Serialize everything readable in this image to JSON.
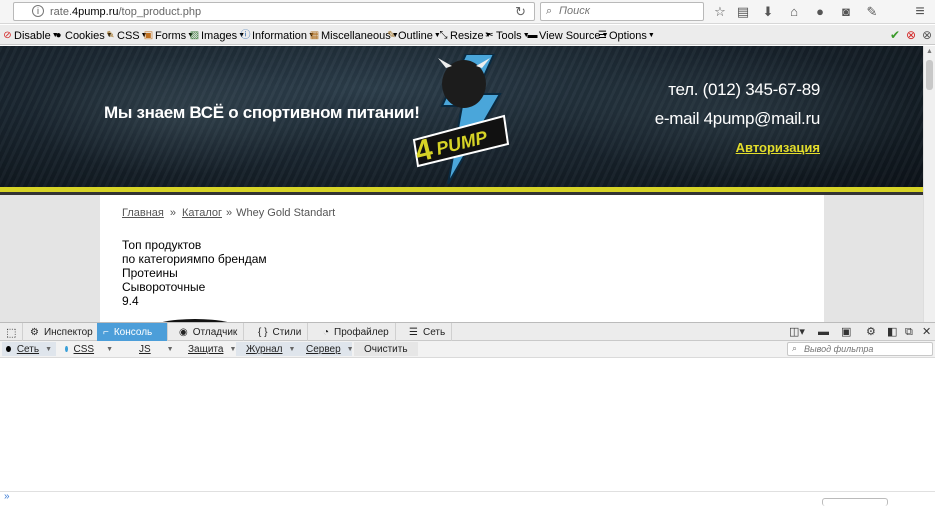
{
  "browser": {
    "url_prefix": "rate.",
    "url_domain": "4pump.ru",
    "url_path": "/top_product.php",
    "search_placeholder": "Поиск",
    "nav_icons": [
      "star-icon",
      "reading-list-icon",
      "download-icon",
      "home-icon",
      "chat-icon",
      "pocket-icon",
      "addon-icon",
      "menu-icon"
    ]
  },
  "webdev_toolbar": {
    "items": [
      {
        "label": "Disable",
        "icon": "no-entry-icon"
      },
      {
        "label": "Cookies",
        "icon": "cookie-icon"
      },
      {
        "label": "CSS",
        "icon": "pencil-icon"
      },
      {
        "label": "Forms",
        "icon": "form-icon"
      },
      {
        "label": "Images",
        "icon": "image-icon"
      },
      {
        "label": "Information",
        "icon": "info-icon"
      },
      {
        "label": "Miscellaneous",
        "icon": "misc-icon"
      },
      {
        "label": "Outline",
        "icon": "outline-icon"
      },
      {
        "label": "Resize",
        "icon": "resize-icon"
      },
      {
        "label": "Tools",
        "icon": "tools-icon"
      },
      {
        "label": "View Source",
        "icon": "view-source-icon"
      },
      {
        "label": "Options",
        "icon": "options-icon"
      }
    ],
    "status_ok_color": "#3a9a2a",
    "status_error_color": "#d32323"
  },
  "site": {
    "slogan": "Мы знаем ВСЁ о спортивном питании!",
    "logo_text": "4PUMP",
    "phone": "тел. (012) 345-67-89",
    "email": "e-mail 4pump@mail.ru",
    "login_link": "Авторизация",
    "accent_color": "#d6d326",
    "breadcrumb": {
      "home": "Главная",
      "catalog": "Каталог",
      "current": "Whey Gold Standart",
      "separator": "»"
    },
    "content_lines": [
      "Топ продуктов",
      "по категориямпо брендам",
      "Протеины",
      "Сывороточные",
      "9.4"
    ]
  },
  "devtools": {
    "tabs": [
      {
        "label": "Инспектор",
        "icon": "inspector-icon",
        "active": false
      },
      {
        "label": "Консоль",
        "icon": "console-icon",
        "active": true
      },
      {
        "label": "Отладчик",
        "icon": "debugger-icon",
        "active": false
      },
      {
        "label": "Стили",
        "icon": "braces-icon",
        "active": false
      },
      {
        "label": "Профайлер",
        "icon": "profiler-icon",
        "active": false
      },
      {
        "label": "Сеть",
        "icon": "network-icon",
        "active": false
      }
    ],
    "filters": [
      {
        "label": "Сеть",
        "color": "#000000"
      },
      {
        "label": "CSS",
        "color": "#3aa0d8"
      },
      {
        "label": "JS",
        "color": "#f0a030"
      },
      {
        "label": "Защита",
        "color": "#e23b3b"
      },
      {
        "label": "Журнал",
        "color": "#888888"
      },
      {
        "label": "Сервер",
        "color": "#52a552"
      }
    ],
    "clear_label": "Очистить",
    "filter_placeholder": "Вывод фильтра",
    "active_tab_color": "#4c9ed9"
  }
}
